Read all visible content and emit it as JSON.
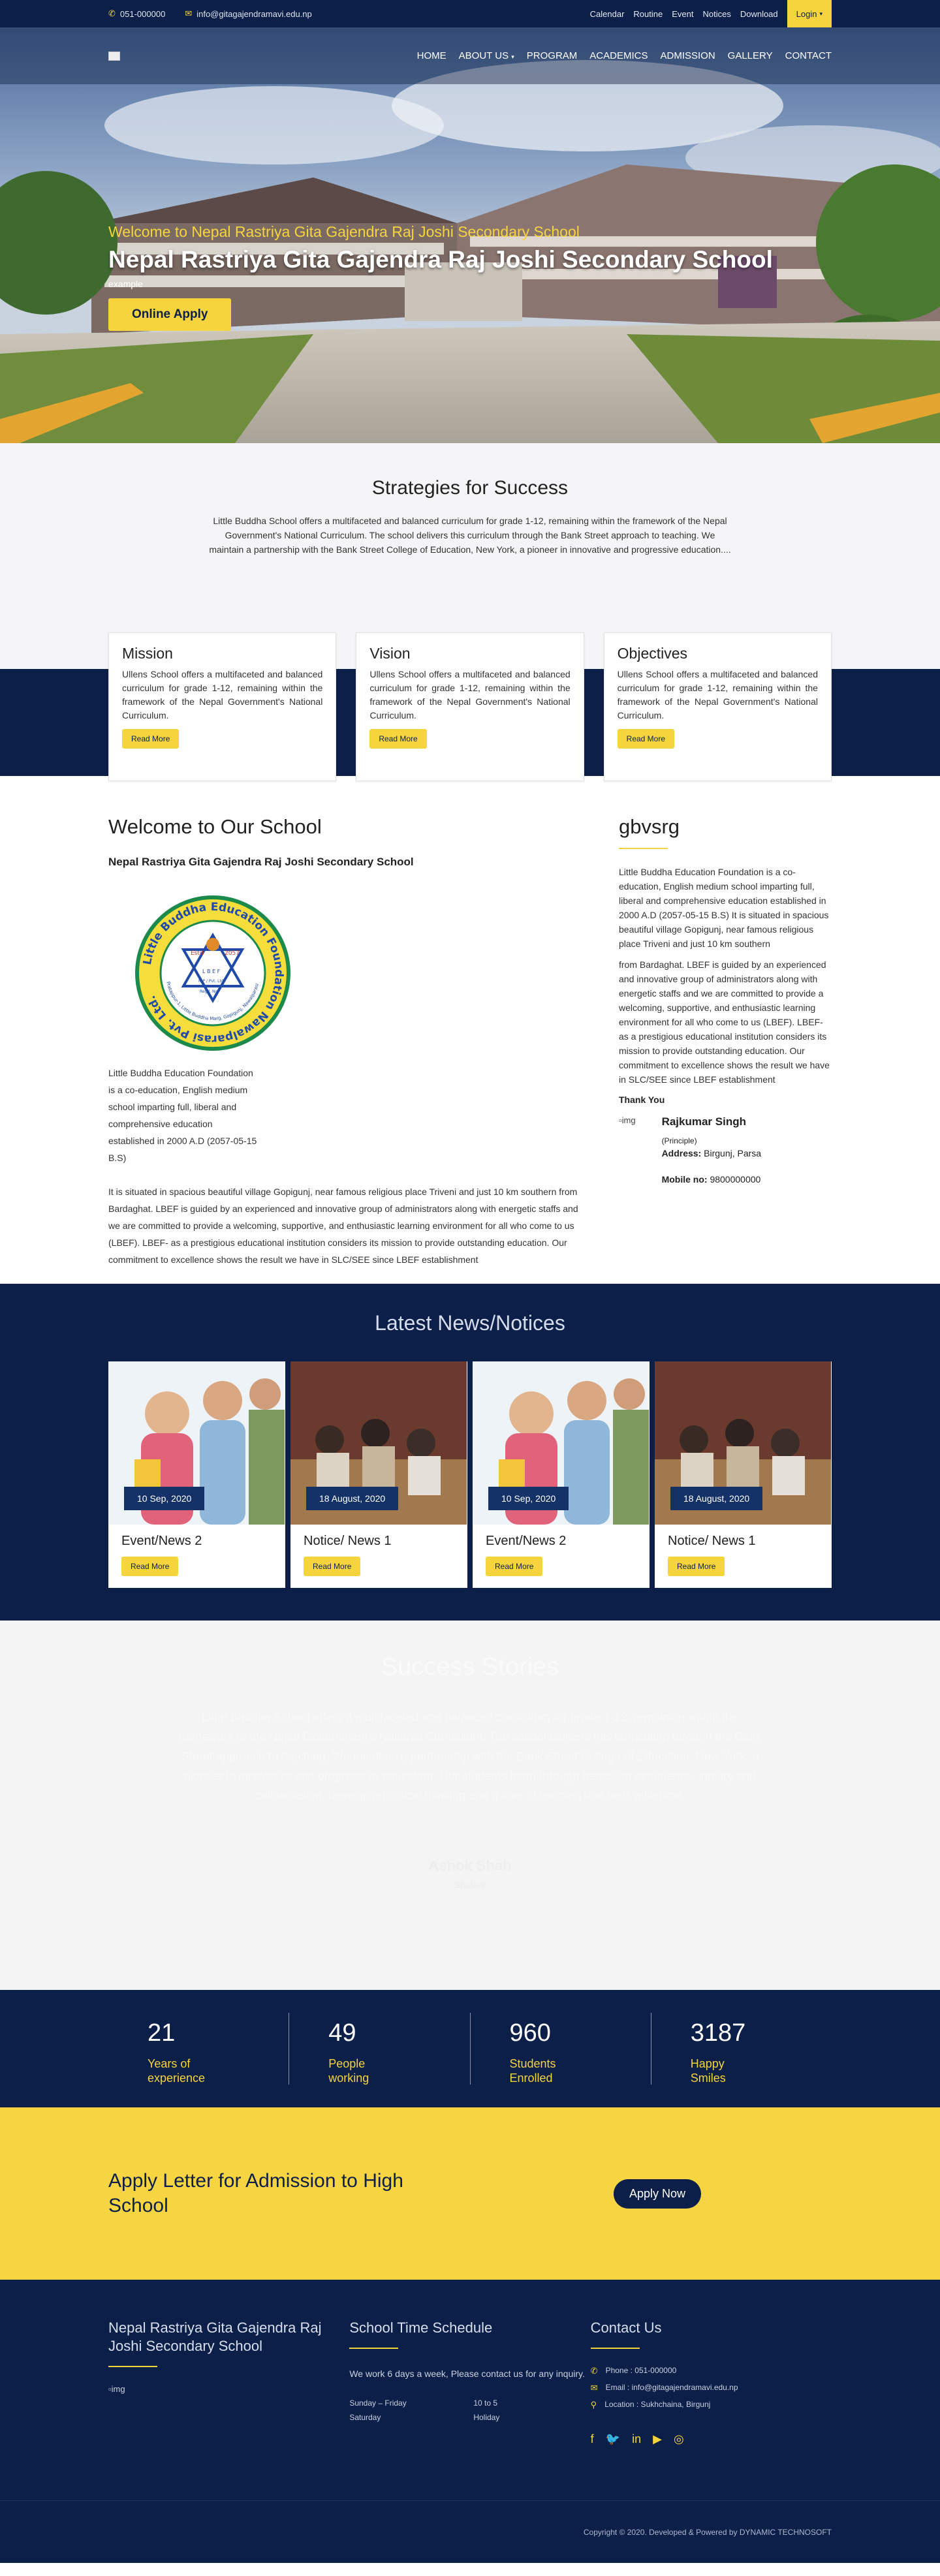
{
  "topbar": {
    "phone": "051-000000",
    "email": "info@gitagajendramavi.edu.np",
    "links": [
      "Calendar",
      "Routine",
      "Event",
      "Notices",
      "Download"
    ],
    "login": "Login"
  },
  "nav": {
    "items": [
      "HOME",
      "ABOUT US",
      "PROGRAM",
      "ACADEMICS",
      "ADMISSION",
      "GALLERY",
      "CONTACT"
    ]
  },
  "hero": {
    "subtitle": "Welcome to Nepal Rastriya Gita Gajendra Raj Joshi Secondary School",
    "title": "Nepal Rastriya Gita Gajendra Raj Joshi Secondary School",
    "example": "example",
    "button": "Online Apply"
  },
  "strategies": {
    "title": "Strategies for Success",
    "text": "Little Buddha School offers a multifaceted and balanced curriculum for grade 1-12, remaining within the framework of the Nepal Government's National Curriculum. The school delivers this curriculum through the Bank Street approach to teaching. We maintain a partnership with the Bank Street College of Education, New York, a pioneer in innovative and progressive education...."
  },
  "cards": [
    {
      "title": "Mission",
      "text": "Ullens School offers a multifaceted and balanced curriculum for grade 1-12, remaining within the framework of the Nepal Government's National Curriculum.",
      "button": "Read More"
    },
    {
      "title": "Vision",
      "text": "Ullens School offers a multifaceted and balanced curriculum for grade 1-12, remaining within the framework of the Nepal Government's National Curriculum.",
      "button": "Read More"
    },
    {
      "title": "Objectives",
      "text": "Ullens School offers a multifaceted and balanced curriculum for grade 1-12, remaining within the framework of the Nepal Government's National Curriculum.",
      "button": "Read More"
    }
  ],
  "welcome": {
    "title": "Welcome to Our School",
    "school": "Nepal Rastriya Gita Gajendra Raj Joshi Secondary School",
    "p1": "Little Buddha Education Foundation is a co-education, English medium school imparting full, liberal and comprehensive education established in 2000 A.D (2057-05-15 B.S)",
    "p2": "It is situated in spacious beautiful village Gopigunj, near famous religious place Triveni and just 10 km southern from Bardaghat. LBEF is guided by an experienced and innovative group of administrators along with energetic staffs and we are committed to provide a welcoming, supportive, and enthusiastic learning environment for all who come to us (LBEF). LBEF- as a prestigious educational institution considers its mission to provide outstanding education. Our commitment to excellence shows the result we have in SLC/SEE since LBEF establishment",
    "seal": {
      "outer": "Little Buddha Education Foundation Nawalparasi Pvt. Ltd.",
      "estd": "Estd",
      "year": "2057",
      "inner": "Pratappur-1, Little Buddha Marg, Gopigunj, Nawalparasi",
      "center": "L B E F",
      "reg": "Regd. No.",
      "pvt": "N.P / Pvt. Ltd."
    }
  },
  "sidebar": {
    "title": "gbvsrg",
    "p1": "Little Buddha Education Foundation is a co-education, English medium school imparting full, liberal and comprehensive education established in 2000 A.D (2057-05-15 B.S) It is situated in spacious beautiful village Gopigunj, near famous religious place Triveni and just 10 km southern",
    "p2": "from Bardaghat. LBEF is guided by an experienced and innovative group of administrators along with energetic staffs and we are committed to provide a welcoming, supportive, and enthusiastic learning environment for all who come to us (LBEF). LBEF- as a prestigious educational institution considers its mission to provide outstanding education. Our commitment to excellence shows the result we have in SLC/SEE since LBEF establishment",
    "thanks": "Thank You",
    "img_alt": "img",
    "name": "Rajkumar Singh",
    "role": "(Principle)",
    "address_label": "Address:",
    "address": "Birgunj, Parsa",
    "mobile_label": "Mobile no:",
    "mobile": "9800000000"
  },
  "news": {
    "title": "Latest News/Notices",
    "items": [
      {
        "date": "10 Sep, 2020",
        "title": "Event/News 2",
        "button": "Read More"
      },
      {
        "date": "18 August, 2020",
        "title": "Notice/ News 1",
        "button": "Read More"
      },
      {
        "date": "10 Sep, 2020",
        "title": "Event/News 2",
        "button": "Read More"
      },
      {
        "date": "18 August, 2020",
        "title": "Notice/ News 1",
        "button": "Read More"
      }
    ]
  },
  "success": {
    "title": "Success Stories",
    "text": "Little Buddha School offers a multifaceted and balanced curriculum for grade 1-12, remaining within the framework of the Nepal Government's National Curriculum. The school delivers this curriculum through the Bank Street approach to teaching. We maintain a partnership with the Bank Street College of Education, New York, a pioneer in innovative and progressive education. Our students learn through hands-on experience, inquiry and collaboration, developing critical thinking and a love of learning that lasts a lifetime.",
    "name": "Ashok Shah",
    "role": "Student"
  },
  "stats": [
    {
      "num": "21",
      "label": "Years of experience"
    },
    {
      "num": "49",
      "label": "People working"
    },
    {
      "num": "960",
      "label": "Students Enrolled"
    },
    {
      "num": "3187",
      "label": "Happy Smiles"
    }
  ],
  "admission": {
    "title": "Apply Letter for Admission to High School",
    "button": "Apply Now"
  },
  "footer": {
    "school": "Nepal Rastriya Gita Gajendra Raj Joshi Secondary School",
    "img_alt": "img",
    "schedule_title": "School Time Schedule",
    "schedule_text": "We work 6 days a week, Please contact us for any inquiry.",
    "rows": [
      {
        "day": "Sunday – Friday",
        "time": "10 to 5"
      },
      {
        "day": "Saturday",
        "time": "Holiday"
      }
    ],
    "contact_title": "Contact Us",
    "phone": "Phone : 051-000000",
    "email": "Email : info@gitagajendramavi.edu.np",
    "location": "Location : Sukhchaina, Birgunj",
    "copyright": "Copyright © 2020. Developed & Powered by DYNAMIC TECHNOSOFT"
  },
  "colors": {
    "navy": "#0c1f48",
    "yellow": "#f5d43e"
  }
}
